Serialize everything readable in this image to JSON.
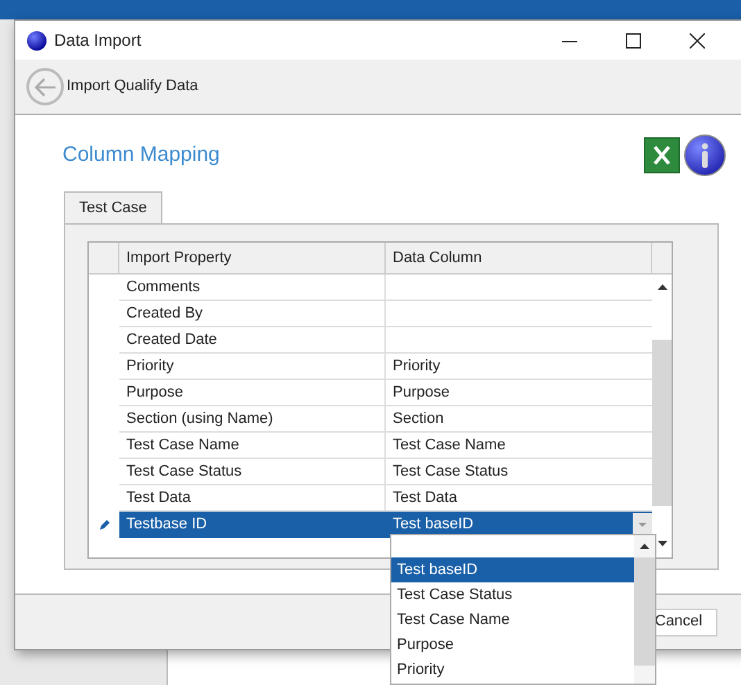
{
  "window": {
    "title": "Data Import"
  },
  "toolbar": {
    "title": "Import Qualify Data"
  },
  "heading": "Column Mapping",
  "tabs": [
    {
      "label": "Test Case",
      "selected": true
    }
  ],
  "grid": {
    "columns": [
      "Import Property",
      "Data Column"
    ],
    "rows": [
      {
        "property": "Comments",
        "column": "",
        "selected": false,
        "editing": false
      },
      {
        "property": "Created By",
        "column": "",
        "selected": false,
        "editing": false
      },
      {
        "property": "Created Date",
        "column": "",
        "selected": false,
        "editing": false
      },
      {
        "property": "Priority",
        "column": "Priority",
        "selected": false,
        "editing": false
      },
      {
        "property": "Purpose",
        "column": "Purpose",
        "selected": false,
        "editing": false
      },
      {
        "property": "Section (using Name)",
        "column": "Section",
        "selected": false,
        "editing": false
      },
      {
        "property": "Test Case Name",
        "column": "Test Case Name",
        "selected": false,
        "editing": false
      },
      {
        "property": "Test Case Status",
        "column": "Test Case Status",
        "selected": false,
        "editing": false
      },
      {
        "property": "Test Data",
        "column": "Test Data",
        "selected": false,
        "editing": false
      },
      {
        "property": "Testbase ID",
        "column": "Test baseID",
        "selected": true,
        "editing": true
      }
    ]
  },
  "dropdown": {
    "options": [
      {
        "label": "Test baseID",
        "selected": true
      },
      {
        "label": "Test Case Status",
        "selected": false
      },
      {
        "label": "Test Case Name",
        "selected": false
      },
      {
        "label": "Purpose",
        "selected": false
      },
      {
        "label": "Priority",
        "selected": false
      }
    ]
  },
  "buttons": [
    "Cancel"
  ]
}
